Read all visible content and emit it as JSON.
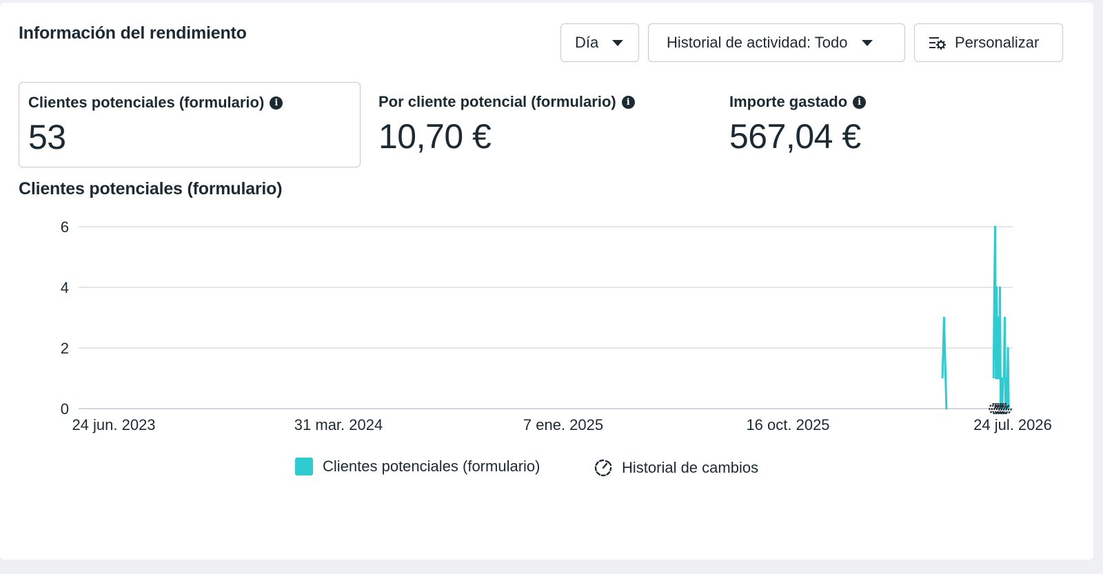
{
  "header": {
    "title": "Información del rendimiento",
    "day_label": "Día",
    "history_label": "Historial de actividad: Todo",
    "customize_label": "Personalizar"
  },
  "metrics": [
    {
      "label": "Clientes potenciales (formulario)",
      "value": "53",
      "info_icon": "info-icon"
    },
    {
      "label": "Por cliente potencial (formulario)",
      "value": "10,70 €",
      "info_icon": "info-icon"
    },
    {
      "label": "Importe gastado",
      "value": "567,04 €",
      "info_icon": "info-icon"
    }
  ],
  "chart_title": "Clientes potenciales (formulario)",
  "colors": {
    "series": "#2ecbd0",
    "text": "#1c2b33",
    "grid": "#dadde1"
  },
  "chart_data": {
    "type": "line",
    "y_ticks": [
      "0",
      "2",
      "4",
      "6"
    ],
    "ylim": [
      0,
      6
    ],
    "x_ticks": [
      "24 jun. 2023",
      "31 mar. 2024",
      "7 ene. 2025",
      "16 oct. 2025",
      "24 jul. 2026"
    ],
    "xlim": [
      "2023-06-24",
      "2026-07-24"
    ],
    "grid": true,
    "series": [
      {
        "name": "Clientes potenciales (formulario)",
        "segments": [
          [
            [
              "2026-04-27",
              1
            ],
            [
              "2026-04-29",
              3
            ],
            [
              "2026-05-01",
              1
            ],
            [
              "2026-05-02",
              0
            ],
            [
              "2026-05-03",
              0
            ]
          ],
          [
            [
              "2026-06-30",
              1
            ],
            [
              "2026-07-01",
              4
            ],
            [
              "2026-07-02",
              6
            ],
            [
              "2026-07-03",
              1
            ],
            [
              "2026-07-04",
              4
            ],
            [
              "2026-07-05",
              1
            ],
            [
              "2026-07-06",
              3
            ],
            [
              "2026-07-07",
              1
            ],
            [
              "2026-07-08",
              4
            ],
            [
              "2026-07-09",
              0
            ],
            [
              "2026-07-10",
              1
            ],
            [
              "2026-07-11",
              0
            ],
            [
              "2026-07-12",
              1
            ],
            [
              "2026-07-13",
              1
            ],
            [
              "2026-07-14",
              3
            ],
            [
              "2026-07-15",
              0
            ],
            [
              "2026-07-16",
              1
            ],
            [
              "2026-07-17",
              0
            ],
            [
              "2026-07-18",
              2
            ],
            [
              "2026-07-19",
              0
            ]
          ]
        ]
      }
    ],
    "change_markers": [
      "2026-07-01",
      "2026-07-04",
      "2026-07-07",
      "2026-07-10",
      "2026-07-13",
      "2026-07-16"
    ],
    "legend": [
      {
        "label": "Clientes potenciales (formulario)",
        "icon": "swatch"
      },
      {
        "label": "Historial de cambios",
        "icon": "change-history-icon"
      }
    ]
  }
}
